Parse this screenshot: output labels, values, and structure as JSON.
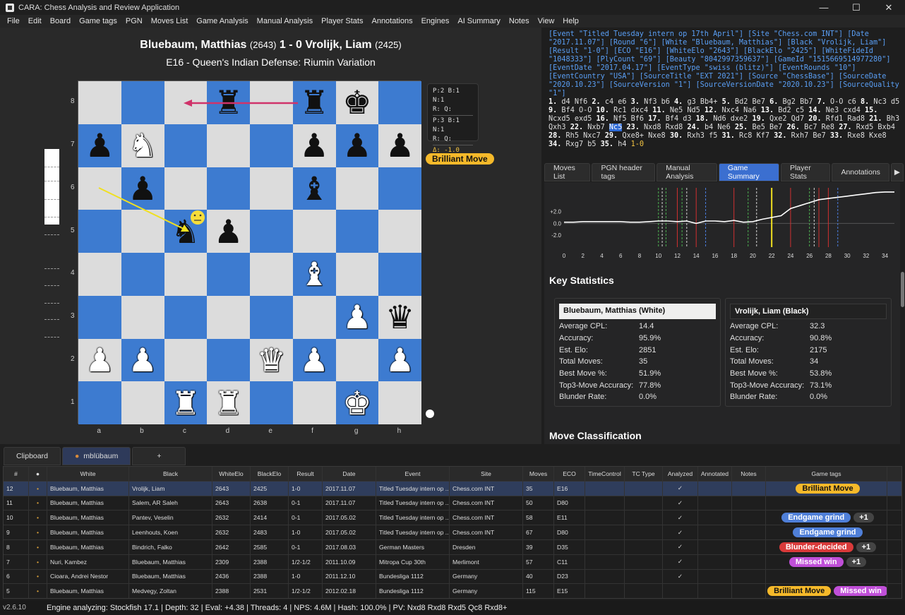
{
  "window": {
    "title": "CARA: Chess Analysis and Review Application",
    "min": "—",
    "max": "☐",
    "close": "✕"
  },
  "menu": [
    "File",
    "Edit",
    "Board",
    "Game tags",
    "PGN",
    "Moves List",
    "Game Analysis",
    "Manual Analysis",
    "Player Stats",
    "Annotations",
    "Engines",
    "AI Summary",
    "Notes",
    "View",
    "Help"
  ],
  "game": {
    "white": "Bluebaum, Matthias",
    "white_elo": "(2643)",
    "result": "1 - 0",
    "black": "Vrolijk, Liam",
    "black_elo": "(2425)",
    "opening": "E16 - Queen's Indian Defense: Riumin Variation"
  },
  "material": {
    "line1": "P:2 B:1 N:1",
    "line2": "R:  Q:",
    "line3": "P:3 B:1 N:1",
    "line4": "R:  Q:",
    "delta": "Δ: -1.0"
  },
  "board_badge": "Brilliant Move",
  "ranks": [
    "8",
    "7",
    "6",
    "5",
    "4",
    "3",
    "2",
    "1"
  ],
  "files": [
    "a",
    "b",
    "c",
    "d",
    "e",
    "f",
    "g",
    "h"
  ],
  "pieces": [
    {
      "sq": "d8",
      "p": "♜",
      "c": "b"
    },
    {
      "sq": "f8",
      "p": "♜",
      "c": "b"
    },
    {
      "sq": "g8",
      "p": "♚",
      "c": "b"
    },
    {
      "sq": "a7",
      "p": "♟",
      "c": "b"
    },
    {
      "sq": "b7",
      "p": "♞",
      "c": "w"
    },
    {
      "sq": "f7",
      "p": "♟",
      "c": "b"
    },
    {
      "sq": "g7",
      "p": "♟",
      "c": "b"
    },
    {
      "sq": "h7",
      "p": "♟",
      "c": "b"
    },
    {
      "sq": "b6",
      "p": "♟",
      "c": "b"
    },
    {
      "sq": "f6",
      "p": "♝",
      "c": "b"
    },
    {
      "sq": "c5",
      "p": "♞",
      "c": "b"
    },
    {
      "sq": "d5",
      "p": "♟",
      "c": "b"
    },
    {
      "sq": "f4",
      "p": "♝",
      "c": "w"
    },
    {
      "sq": "g3",
      "p": "♟",
      "c": "w"
    },
    {
      "sq": "h3",
      "p": "♛",
      "c": "b"
    },
    {
      "sq": "a2",
      "p": "♟",
      "c": "w"
    },
    {
      "sq": "b2",
      "p": "♟",
      "c": "w"
    },
    {
      "sq": "e2",
      "p": "♛",
      "c": "w"
    },
    {
      "sq": "f2",
      "p": "♟",
      "c": "w"
    },
    {
      "sq": "h2",
      "p": "♟",
      "c": "w"
    },
    {
      "sq": "c1",
      "p": "♜",
      "c": "w"
    },
    {
      "sq": "d1",
      "p": "♜",
      "c": "w"
    },
    {
      "sq": "g1",
      "p": "♚",
      "c": "w"
    }
  ],
  "pgn": {
    "headers": "[Event \"Titled Tuesday intern op 17th April\"] [Site \"Chess.com INT\"] [Date \"2017.11.07\"] [Round \"6\"] [White \"Bluebaum, Matthias\"] [Black \"Vrolijk, Liam\"] [Result \"1-0\"] [ECO \"E16\"] [WhiteElo \"2643\"] [BlackElo \"2425\"] [WhiteFideId \"1048333\"] [PlyCount \"69\"] [Beauty \"8042997359637\"] [GameId \"1515669514977280\"] [EventDate \"2017.04.17\"] [EventType \"swiss (blitz)\"] [EventRounds \"10\"] [EventCountry \"USA\"] [SourceTitle \"EXT 2021\"] [Source \"ChessBase\"] [SourceDate \"2020.10.23\"] [SourceVersion \"1\"] [SourceVersionDate \"2020.10.23\"] [SourceQuality \"1\"]",
    "moves_before": "1. d4 Nf6 2. c4 e6 3. Nf3 b6 4. g3 Bb4+ 5. Bd2 Be7 6. Bg2 Bb7 7. O-O c6 8. Nc3 d5 9. Bf4 O-O 10. Rc1 dxc4 11. Ne5 Nd5 12. Nxc4 Na6 13. Bd2 c5 14. Ne3 cxd4 15. Ncxd5 exd5 16. Nf5 Bf6 17. Bf4 d3 18. Nd6 dxe2 19. Qxe2 Qd7 20. Rfd1 Rad8 21. Bh3 Qxh3 22. Nxb7",
    "current": "Nc5",
    "moves_after": "23. Nxd8 Rxd8 24. b4 Ne6 25. Be5 Be7 26. Bc7 Re8 27. Rxd5 Bxb4 28. Rh5 Nxc7 29. Qxe8+ Nxe8 30. Rxh3 f5 31. Rc8 Kf7 32. Rxh7 Be7 33. Rxe8 Kxe8 34. Rxg7 b5 35. h4",
    "result": "1-0"
  },
  "tabs": [
    "Moves List",
    "PGN header tags",
    "Manual Analysis",
    "Game Summary",
    "Player Stats",
    "Annotations"
  ],
  "chart_data": {
    "type": "line",
    "x": [
      0,
      1,
      2,
      3,
      4,
      5,
      6,
      7,
      8,
      9,
      10,
      11,
      12,
      13,
      14,
      15,
      16,
      17,
      18,
      19,
      20,
      21,
      22,
      23,
      24,
      25,
      26,
      27,
      28,
      29,
      30,
      31,
      32,
      33,
      34,
      35
    ],
    "values": [
      0.2,
      0.2,
      0.3,
      0.3,
      0.3,
      0.3,
      0.3,
      0.2,
      0.2,
      0.3,
      0.4,
      0.4,
      0.3,
      0.4,
      0.0,
      0.4,
      0.4,
      0.3,
      0.5,
      0.2,
      0.3,
      0.7,
      1.0,
      1.3,
      2.5,
      3.0,
      3.5,
      4.0,
      4.2,
      4.4,
      4.6,
      4.8,
      5.0,
      5.2,
      5.3,
      5.3
    ],
    "yticks": [
      "+2.0",
      "0.0",
      "-2.0"
    ],
    "xticks": [
      0,
      2,
      4,
      6,
      8,
      10,
      12,
      14,
      16,
      18,
      20,
      22,
      24,
      26,
      28,
      30,
      32,
      34
    ],
    "ylim": [
      -4,
      6
    ],
    "markers": [
      {
        "x": 10,
        "c": "#4caf50"
      },
      {
        "x": 10.4,
        "c": "#d4d4d4"
      },
      {
        "x": 10.8,
        "c": "#4caf50"
      },
      {
        "x": 12,
        "c": "#d03030"
      },
      {
        "x": 12.5,
        "c": "#4caf50"
      },
      {
        "x": 13,
        "c": "#d4d4d4"
      },
      {
        "x": 14,
        "c": "#d03030"
      },
      {
        "x": 15,
        "c": "#4c7fe0"
      },
      {
        "x": 18,
        "c": "#d03030"
      },
      {
        "x": 19.5,
        "c": "#4caf50"
      },
      {
        "x": 20.4,
        "c": "#d4d4d4"
      },
      {
        "x": 22,
        "c": "#f0e020"
      },
      {
        "x": 24,
        "c": "#d03030"
      },
      {
        "x": 26,
        "c": "#4caf50"
      },
      {
        "x": 26.5,
        "c": "#d4d4d4"
      },
      {
        "x": 27,
        "c": "#d03030"
      },
      {
        "x": 28,
        "c": "#d03030"
      },
      {
        "x": 29,
        "c": "#4c7fe0"
      }
    ]
  },
  "key_statistics": "Key Statistics",
  "move_classification": "Move Classification",
  "white_stats": {
    "name": "Bluebaum, Matthias (White)",
    "rows": [
      [
        "Average CPL:",
        "14.4"
      ],
      [
        "Accuracy:",
        "95.9%"
      ],
      [
        "Est. Elo:",
        "2851"
      ],
      [
        "Total Moves:",
        "35"
      ],
      [
        "Best Move %:",
        "51.9%"
      ],
      [
        "Top3-Move Accuracy:",
        "77.8%"
      ],
      [
        "Blunder Rate:",
        "0.0%"
      ]
    ]
  },
  "black_stats": {
    "name": "Vrolijk, Liam (Black)",
    "rows": [
      [
        "Average CPL:",
        "32.3"
      ],
      [
        "Accuracy:",
        "90.8%"
      ],
      [
        "Est. Elo:",
        "2175"
      ],
      [
        "Total Moves:",
        "34"
      ],
      [
        "Best Move %:",
        "53.8%"
      ],
      [
        "Top3-Move Accuracy:",
        "73.1%"
      ],
      [
        "Blunder Rate:",
        "0.0%"
      ]
    ]
  },
  "db_tabs": [
    "Clipboard",
    "mblübaum",
    "+"
  ],
  "table": {
    "headers": [
      "#",
      "●",
      "White",
      "Black",
      "WhiteElo",
      "BlackElo",
      "Result",
      "Date",
      "Event",
      "Site",
      "Moves",
      "ECO",
      "TimeControl",
      "TC Type",
      "Analyzed",
      "Annotated",
      "Notes",
      "Game tags"
    ],
    "rows": [
      [
        "12",
        "•",
        "Bluebaum, Matthias",
        "Vrolijk, Liam",
        "2643",
        "2425",
        "1-0",
        "2017.11.07",
        "Titled Tuesday intern op ...",
        "Chess.com INT",
        "35",
        "E16",
        "",
        "",
        "✓",
        "",
        "",
        ""
      ],
      [
        "11",
        "•",
        "Bluebaum, Matthias",
        "Salem, AR Saleh",
        "2643",
        "2638",
        "0-1",
        "2017.11.07",
        "Titled Tuesday intern op ...",
        "Chess.com INT",
        "50",
        "D80",
        "",
        "",
        "✓",
        "",
        "",
        ""
      ],
      [
        "10",
        "•",
        "Bluebaum, Matthias",
        "Pantev, Veselin",
        "2632",
        "2414",
        "0-1",
        "2017.05.02",
        "Titled Tuesday intern op ...",
        "Chess.com INT",
        "58",
        "E11",
        "",
        "",
        "✓",
        "",
        "",
        ""
      ],
      [
        "9",
        "•",
        "Bluebaum, Matthias",
        "Leenhouts, Koen",
        "2632",
        "2483",
        "1-0",
        "2017.05.02",
        "Titled Tuesday intern op ...",
        "Chess.com INT",
        "67",
        "D80",
        "",
        "",
        "✓",
        "",
        "",
        ""
      ],
      [
        "8",
        "•",
        "Bluebaum, Matthias",
        "Bindrich, Falko",
        "2642",
        "2585",
        "0-1",
        "2017.08.03",
        "German Masters",
        "Dresden",
        "39",
        "D35",
        "",
        "",
        "✓",
        "",
        "",
        ""
      ],
      [
        "7",
        "•",
        "Nuri, Kambez",
        "Bluebaum, Matthias",
        "2309",
        "2388",
        "1/2-1/2",
        "2011.10.09",
        "Mitropa Cup 30th",
        "Merlimont",
        "57",
        "C11",
        "",
        "",
        "✓",
        "",
        "",
        ""
      ],
      [
        "6",
        "•",
        "Cioara, Andrei Nestor",
        "Bluebaum, Matthias",
        "2436",
        "2388",
        "1-0",
        "2011.12.10",
        "Bundesliga 1112",
        "Germany",
        "40",
        "D23",
        "",
        "",
        "✓",
        "",
        "",
        ""
      ],
      [
        "5",
        "•",
        "Bluebaum, Matthias",
        "Medvegy, Zoltan",
        "2388",
        "2531",
        "1/2-1/2",
        "2012.02.18",
        "Bundesliga 1112",
        "Germany",
        "115",
        "E15",
        "",
        "",
        "",
        "",
        "",
        ""
      ]
    ],
    "tags": [
      [
        [
          "Brilliant Move",
          "brilliant"
        ]
      ],
      [],
      [
        [
          "Endgame grind",
          "grind"
        ],
        [
          "+1",
          "plus"
        ]
      ],
      [
        [
          "Endgame grind",
          "grind"
        ]
      ],
      [
        [
          "Blunder-decided",
          "blunder"
        ],
        [
          "+1",
          "plus"
        ]
      ],
      [
        [
          "Missed win",
          "missed"
        ],
        [
          "+1",
          "plus"
        ]
      ],
      [],
      [
        [
          "Brilliant Move",
          "brilliant"
        ],
        [
          "Missed win",
          "missed"
        ]
      ]
    ]
  },
  "status": {
    "version": "v2.6.10",
    "engine": "Engine analyzing: Stockfish 17.1 | Depth: 32 | Eval: +4.38 | Threads: 4 | NPS: 4.6M | Hash: 100.0% | PV: Nxd8 Rxd8 Rxd5 Qc8 Rxd8+"
  }
}
